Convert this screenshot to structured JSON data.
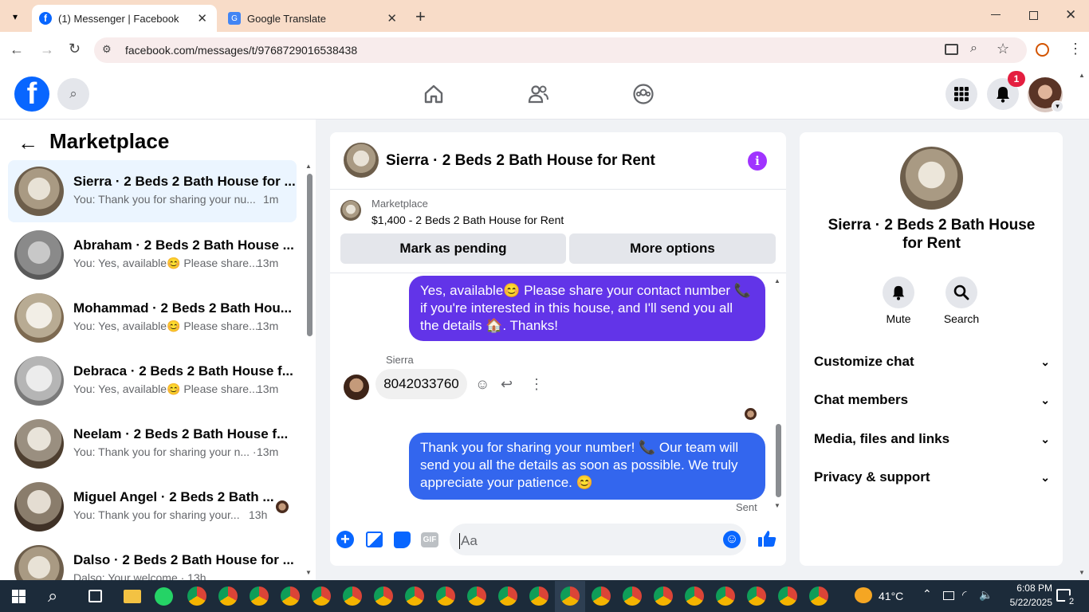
{
  "browser": {
    "tabs": [
      {
        "title": "(1) Messenger | Facebook"
      },
      {
        "title": "Google Translate"
      }
    ],
    "url": "facebook.com/messages/t/9768729016538438"
  },
  "header": {
    "notification_count": "1"
  },
  "sidebar": {
    "title": "Marketplace",
    "conversations": [
      {
        "name": "Sierra · 2 Beds 2 Bath House for ...",
        "preview": "You: Thank you for sharing your nu...",
        "time": "1m"
      },
      {
        "name": "Abraham · 2 Beds 2 Bath House ...",
        "preview": "You: Yes, available😊 Please share...",
        "time": "13m"
      },
      {
        "name": "Mohammad · 2 Beds 2 Bath Hou...",
        "preview": "You: Yes, available😊 Please share...",
        "time": "13m"
      },
      {
        "name": "Debraca · 2 Beds 2 Bath House f...",
        "preview": "You: Yes, available😊 Please share...",
        "time": "13m"
      },
      {
        "name": "Neelam · 2 Beds 2 Bath House f...",
        "preview": "You: Thank you for sharing your n... ·",
        "time": "13m"
      },
      {
        "name": "Miguel Angel · 2 Beds 2 Bath ...",
        "preview": "You: Thank you for sharing your...",
        "time": "13h"
      },
      {
        "name": "Dalso · 2 Beds 2 Bath House for ...",
        "preview": "Dalso: Your welcome · 13h",
        "time": ""
      }
    ]
  },
  "chat": {
    "title": "Sierra · 2 Beds 2 Bath House for Rent",
    "listing_source": "Marketplace",
    "listing_title": "$1,400 - 2 Beds 2 Bath House for Rent",
    "mark_pending_label": "Mark as pending",
    "more_options_label": "More options",
    "msg1": "Yes, available😊 Please share your contact number 📞 if you're interested in this house, and I'll send you all the details 🏠. Thanks!",
    "sender_name": "Sierra",
    "msg2": "8042033760",
    "msg3": "Thank you for sharing your number! 📞 Our team will send you all the details as soon as possible. We truly appreciate your patience. 😊",
    "status": "Sent",
    "composer_placeholder": "Aa",
    "gif_label": "GIF"
  },
  "info": {
    "title": "Sierra · 2 Beds 2 Bath House for Rent",
    "mute_label": "Mute",
    "search_label": "Search",
    "sections": [
      "Customize chat",
      "Chat members",
      "Media, files and links",
      "Privacy & support"
    ]
  },
  "taskbar": {
    "weather": "41°C",
    "time": "6:08 PM",
    "date": "5/22/2025",
    "notif_count": "2"
  },
  "colors": {
    "accent_purple": "#6234e8",
    "accent_blue": "#3366ee",
    "fb_blue": "#0866ff"
  }
}
